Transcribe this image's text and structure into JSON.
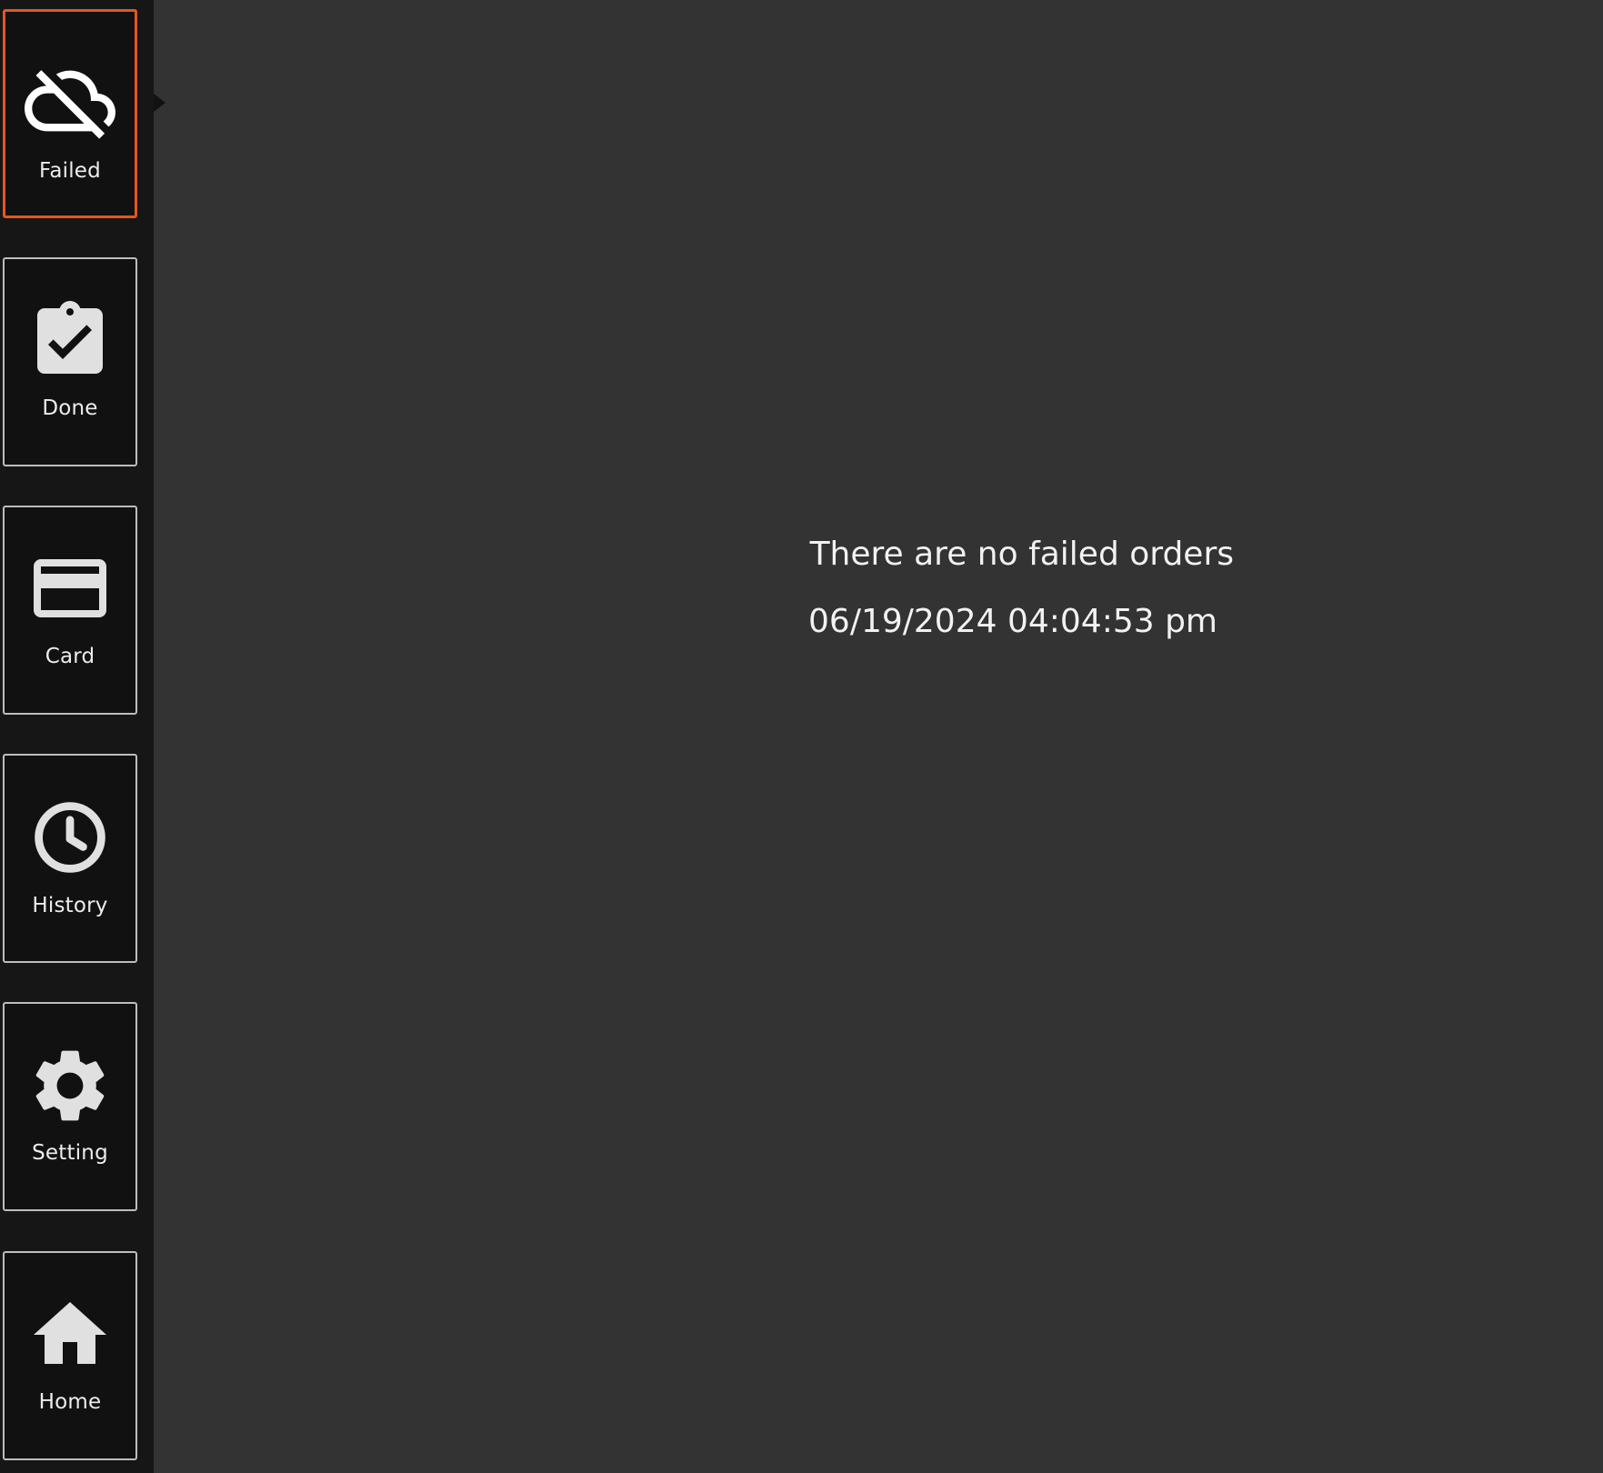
{
  "sidebar": {
    "active_item": "Failed",
    "active_color": "#e4571f",
    "items": [
      {
        "label": "Failed",
        "icon": "cloud-off-icon"
      },
      {
        "label": "Done",
        "icon": "clipboard-check-icon"
      },
      {
        "label": "Card",
        "icon": "credit-card-icon"
      },
      {
        "label": "History",
        "icon": "clock-icon"
      },
      {
        "label": "Setting",
        "icon": "gear-icon"
      },
      {
        "label": "Home",
        "icon": "home-icon"
      }
    ]
  },
  "main": {
    "empty_message": "There are no failed orders",
    "timestamp": "06/19/2024 04:04:53 pm"
  }
}
